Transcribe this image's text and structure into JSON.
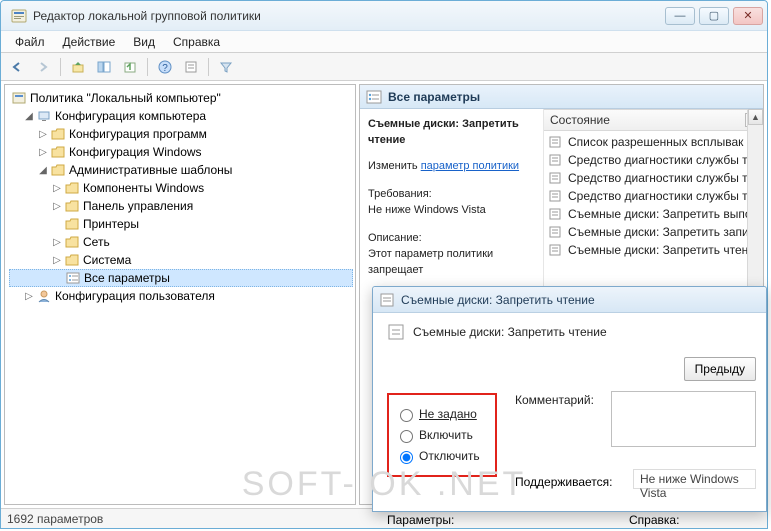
{
  "window": {
    "title": "Редактор локальной групповой политики"
  },
  "menu": {
    "file": "Файл",
    "action": "Действие",
    "view": "Вид",
    "help": "Справка"
  },
  "tree": {
    "root": "Политика \"Локальный компьютер\"",
    "computer": "Конфигурация компьютера",
    "programs": "Конфигурация программ",
    "windows": "Конфигурация Windows",
    "admin": "Административные шаблоны",
    "components": "Компоненты Windows",
    "controlpanel": "Панель управления",
    "printers": "Принтеры",
    "network": "Сеть",
    "system": "Система",
    "allsettings": "Все параметры",
    "user": "Конфигурация пользователя"
  },
  "right": {
    "header": "Все параметры",
    "setting_name": "Съемные диски: Запретить чтение",
    "edit_label": "Изменить",
    "edit_link": "параметр политики",
    "req_label": "Требования:",
    "req_val": "Не ниже Windows Vista",
    "desc_label": "Описание:",
    "desc_text": "Этот параметр политики запрещает",
    "col_state": "Состояние",
    "items": [
      "Список разрешенных всплывак",
      "Средство диагностики службы т",
      "Средство диагностики службы т",
      "Средство диагностики службы т",
      "Съемные диски: Запретить выпо",
      "Съемные диски: Запретить запи",
      "Съемные диски: Запретить чтен"
    ]
  },
  "dialog": {
    "title": "Съемные диски: Запретить чтение",
    "name": "Съемные диски: Запретить чтение",
    "prev": "Предыду",
    "radio_notconfigured": "Не задано",
    "radio_enable": "Включить",
    "radio_disable": "Отключить",
    "comment_label": "Комментарий:",
    "supports_label": "Поддерживается:",
    "supports_value": "Не ниже Windows Vista",
    "params_label": "Параметры:",
    "help_label": "Справка:"
  },
  "statusbar": {
    "text": "1692 параметров"
  },
  "watermark": "SOFT- OK .NET"
}
